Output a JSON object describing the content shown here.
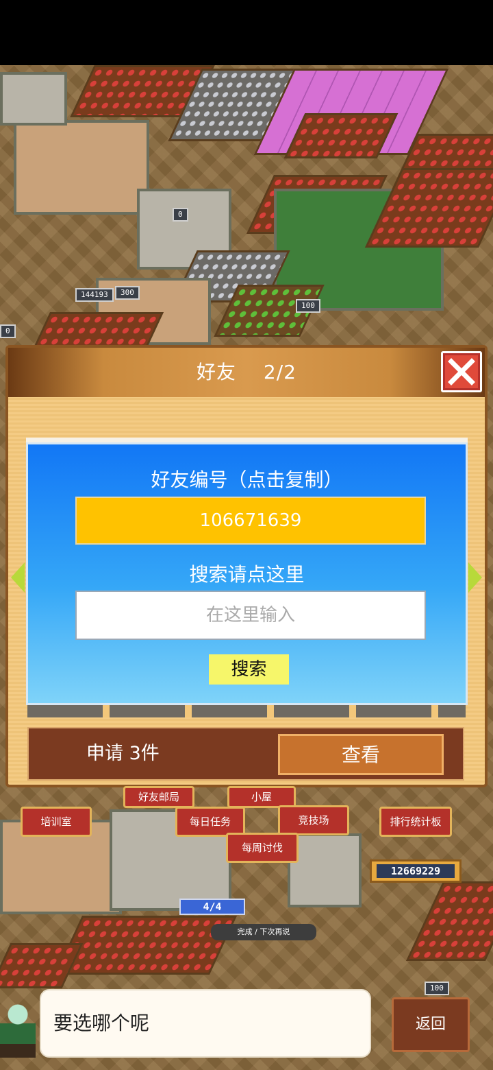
{
  "dialog": {
    "title": "好友",
    "page_indicator": "2/2",
    "friend_id_label": "好友编号（点击复制）",
    "friend_id_value": "106671639",
    "search_label": "搜索请点这里",
    "search_placeholder": "在这里输入",
    "search_button": "搜索",
    "requests_label": "申请 3件",
    "view_button": "查看"
  },
  "world": {
    "signs": [
      "144193",
      "300",
      "100",
      "0",
      "0",
      "100"
    ],
    "buildings": {
      "friend_post": "好友邮局",
      "cabin": "小屋",
      "training_room": "培训室",
      "daily_tasks": "每日任务",
      "arena": "竞技场",
      "leaderboard": "排行统计板",
      "weekly_hunt": "每周讨伐"
    },
    "score": "12669229",
    "progress": "4/4",
    "done_text": "完成 / 下次再说"
  },
  "bottom": {
    "speech": "要选哪个呢",
    "back": "返回"
  },
  "colors": {
    "panel": "#f3c77a",
    "dialog_blue": "#1277f5",
    "id_box": "#ffc200",
    "search_button": "#f6f66a",
    "close": "#e04a3a"
  }
}
